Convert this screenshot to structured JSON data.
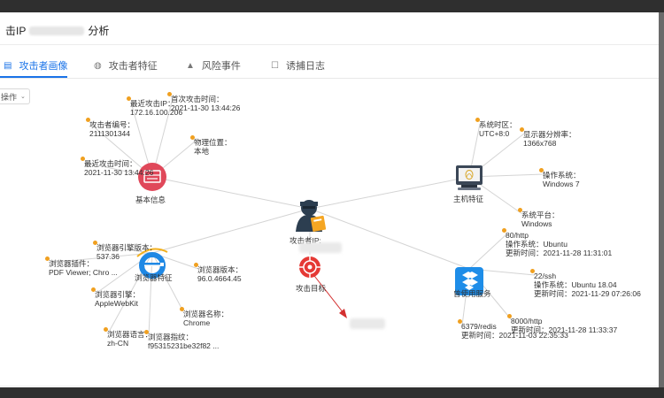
{
  "dialog": {
    "title_prefix": "击IP",
    "title_suffix": "分析"
  },
  "tabs": [
    {
      "label": "攻击者画像",
      "icon": "profile-icon",
      "active": true
    },
    {
      "label": "攻击者特征",
      "icon": "fingerprint-icon",
      "active": false
    },
    {
      "label": "风险事件",
      "icon": "bell-icon",
      "active": false
    },
    {
      "label": "诱捕日志",
      "icon": "log-icon",
      "active": false
    }
  ],
  "toolbar": {
    "ops_label": "操作"
  },
  "colors": {
    "accent": "#1a73e8",
    "leaf_dot": "#f0a020",
    "basic_node": "#e0485a",
    "browser_node": "#1e88e5",
    "service_node": "#1e8de8",
    "target_node": "#e53935",
    "edge": "#cfcfcf",
    "target_edge": "#d32f2f"
  },
  "graph": {
    "center": {
      "label": "攻击者IP:"
    },
    "target": {
      "label": "攻击目标"
    },
    "basic": {
      "label": "基本信息",
      "attacker_id": {
        "name": "攻击者编号：",
        "value": "2111301344"
      },
      "last_ip": {
        "name": "最近攻击IP：",
        "value": "172.16.100.206"
      },
      "first_time": {
        "name": "首次攻击时间：",
        "value": "2021-11-30 13:44:26"
      },
      "location": {
        "name": "物理位置：",
        "value": "本地"
      },
      "last_time": {
        "name": "最近攻击时间：",
        "value": "2021-11-30 13:44:26"
      }
    },
    "host": {
      "label": "主机特征",
      "timezone": {
        "name": "系统时区：",
        "value": "UTC+8:0"
      },
      "resolution": {
        "name": "显示器分辨率：",
        "value": "1366x768"
      },
      "os": {
        "name": "操作系统：",
        "value": "Windows 7"
      },
      "platform": {
        "name": "系统平台：",
        "value": "Windows"
      }
    },
    "browser": {
      "label": "浏览器特征",
      "engine_version": {
        "name": "浏览器引擎版本：",
        "value": "537.36"
      },
      "plugins": {
        "name": "浏览器插件：",
        "value": "PDF Viewer; Chro ..."
      },
      "version": {
        "name": "浏览器版本：",
        "value": "96.0.4664.45"
      },
      "engine": {
        "name": "浏览器引擎：",
        "value": "AppleWebKit"
      },
      "name": {
        "name": "浏览器名称：",
        "value": "Chrome"
      },
      "language": {
        "name": "浏览器语言：",
        "value": "zh-CN"
      },
      "fingerprint": {
        "name": "浏览器指纹：",
        "value": "f95315231be32f82 ..."
      }
    },
    "services": {
      "label": "曾使用服务",
      "http80": {
        "port": "80/http",
        "os_label": "操作系统：",
        "os": "Ubuntu",
        "time_label": "更新时间：",
        "time": "2021-11-28 11:31:01"
      },
      "ssh22": {
        "port": "22/ssh",
        "os_label": "操作系统：",
        "os": "Ubuntu 18.04",
        "time_label": "更新时间：",
        "time": "2021-11-29 07:26:06"
      },
      "http8000": {
        "port": "8000/http",
        "time_label": "更新时间：",
        "time": "2021-11-28 11:33:37"
      },
      "redis6379": {
        "port": "6379/redis",
        "time_label": "更新时间：",
        "time": "2021-11-03 22:35:33"
      }
    }
  }
}
